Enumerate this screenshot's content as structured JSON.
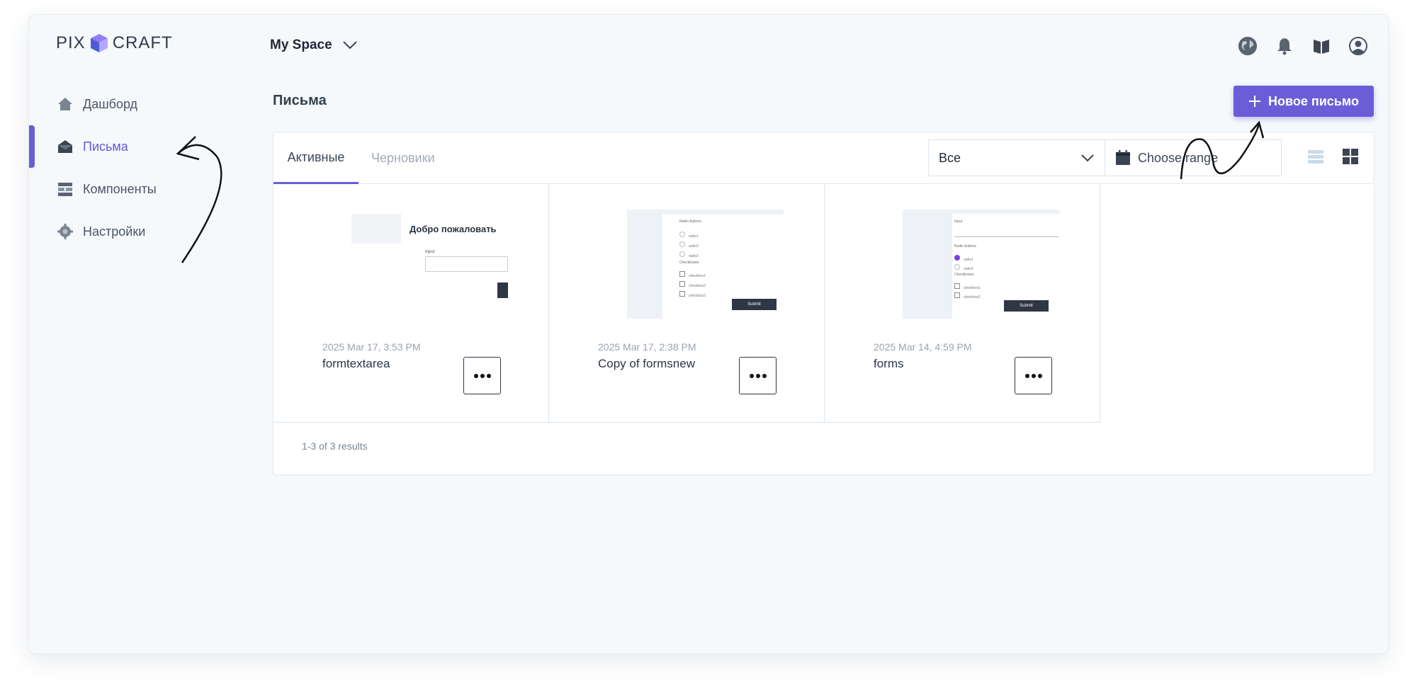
{
  "brand": {
    "left": "PIX",
    "right": "CRAFT"
  },
  "header": {
    "space_name": "My Space"
  },
  "top_icons": [
    "globe-icon",
    "bell-icon",
    "book-icon",
    "user-icon"
  ],
  "sidebar": {
    "items": [
      {
        "label": "Дашборд",
        "icon": "home-icon",
        "active": false
      },
      {
        "label": "Письма",
        "icon": "envelope-icon",
        "active": true
      },
      {
        "label": "Компоненты",
        "icon": "components-icon",
        "active": false
      },
      {
        "label": "Настройки",
        "icon": "gear-icon",
        "active": false
      }
    ]
  },
  "main": {
    "title": "Письма",
    "new_button": "Новое письмо",
    "tabs": [
      {
        "label": "Активные",
        "active": true
      },
      {
        "label": "Черновики",
        "active": false
      }
    ],
    "filter": {
      "selected": "Все"
    },
    "date_range": {
      "placeholder": "Choose range"
    },
    "cards": [
      {
        "date": "2025 Mar 17, 3:53 PM",
        "name": "formtextarea",
        "thumb": {
          "heading": "Добро пожаловать",
          "input_label": "Input"
        }
      },
      {
        "date": "2025 Mar 17, 2:38 PM",
        "name": "Copy of formsnew",
        "thumb": {
          "radio_title": "Radio buttons",
          "radios": [
            "radio1",
            "radio2",
            "radio3"
          ],
          "check_title": "Checkboxes",
          "checks": [
            "checkbox1",
            "checkbox2",
            "checkbox3"
          ],
          "submit": "Submit"
        }
      },
      {
        "date": "2025 Mar 14, 4:59 PM",
        "name": "forms",
        "thumb": {
          "input_label": "Input",
          "radio_title": "Radio buttons",
          "radios": [
            "radio1",
            "radio2"
          ],
          "check_title": "Checkboxes",
          "checks": [
            "checkbox1",
            "checkbox2"
          ],
          "submit": "Submit"
        }
      }
    ],
    "results": "1-3 of 3 results"
  },
  "colors": {
    "accent": "#6a5ed8",
    "text": "#33404f",
    "muted": "#9ba4b0",
    "background": "#f5f9fc"
  }
}
